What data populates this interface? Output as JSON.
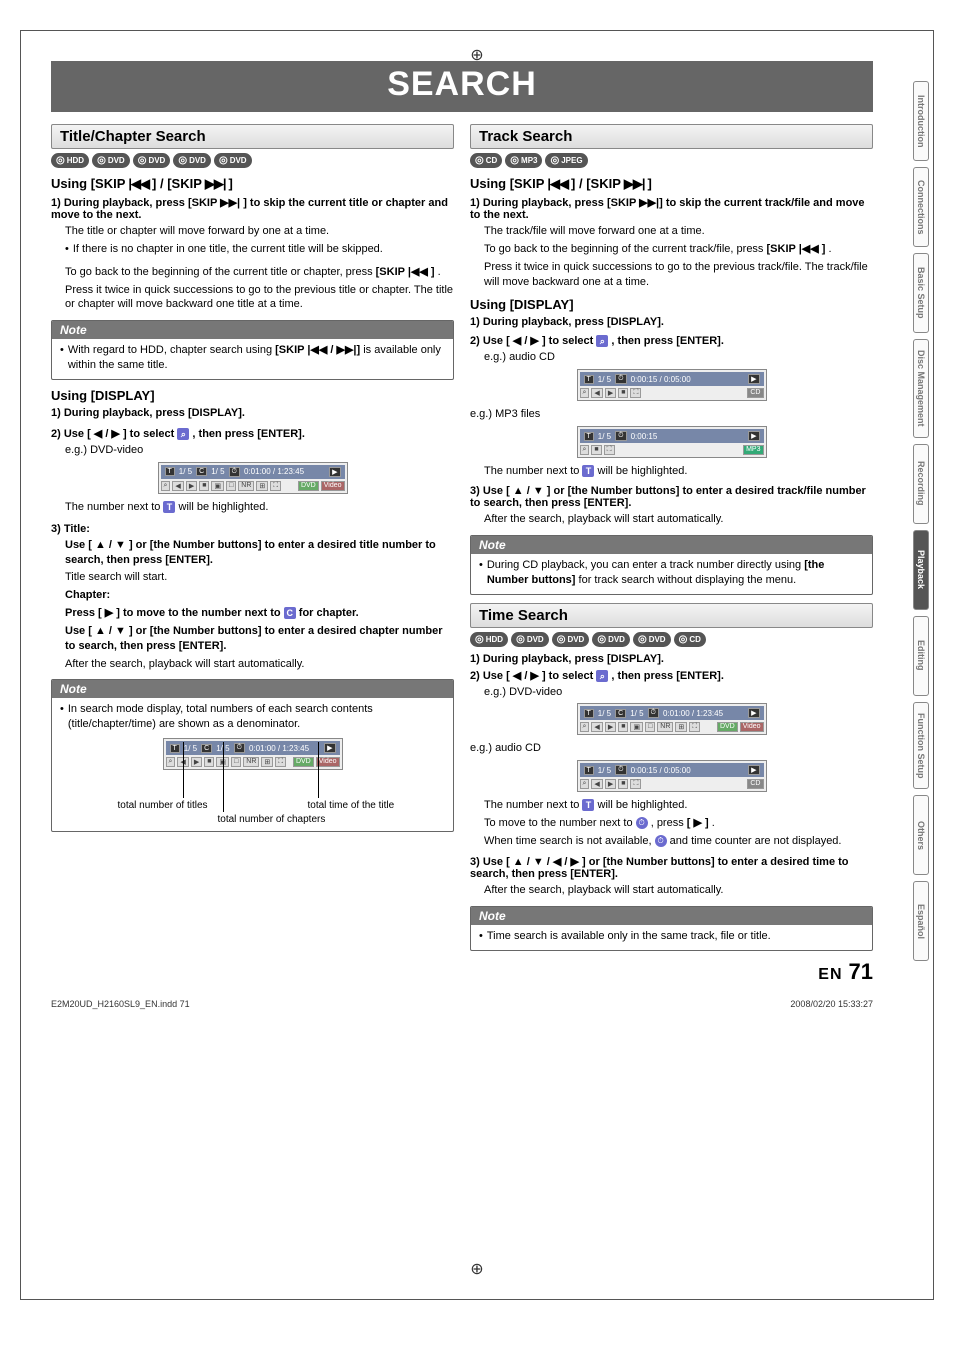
{
  "page_title": "SEARCH",
  "left": {
    "section1": {
      "heading": "Title/Chapter Search",
      "discs": [
        "HDD",
        "DVD",
        "DVD",
        "DVD",
        "DVD"
      ],
      "sub_heading_prefix": "Using [SKIP ",
      "sub_heading_mid": " ] / [SKIP ",
      "sub_heading_suffix": " ]",
      "step1_label": "1)",
      "step1_bold": "During playback, press [SKIP ▶▶| ] to skip the current title or chapter and move to the next.",
      "step1_line1": "The title or chapter will move forward by one at a time.",
      "step1_bullet": "If there is no chapter in one title, the current title will be skipped.",
      "step1_line2a": "To go back to the beginning of the current title or chapter, press ",
      "step1_line2b": "[SKIP |◀◀ ]",
      "step1_line2c": ".",
      "step1_line3": "Press it twice in quick successions to go to the previous title or chapter. The title or chapter will move backward one title at a time.",
      "note_title": "Note",
      "note_body_a": "With regard to HDD, chapter search using ",
      "note_body_b": "[SKIP |◀◀ / ▶▶|]",
      "note_body_c": " is available only within the same title."
    },
    "section2": {
      "heading": "Using [DISPLAY]",
      "step1_label": "1)",
      "step1": "During playback, press [DISPLAY].",
      "step2_label": "2)",
      "step2_a": "Use [ ◀ / ▶ ] to select ",
      "step2_b": " , then press [ENTER].",
      "eg_label": "e.g.) DVD-video",
      "eg_time": "0:01:00 / 1:23:45",
      "eg_tc": "1/  5",
      "eg_cc": "1/  5",
      "eg_badges": [
        "DVD",
        "Video"
      ],
      "after_eg_a": "The number next to ",
      "after_eg_b": " will be highlighted.",
      "step3_label": "3)",
      "step3_heading": "Title:",
      "step3_title_line1": "Use [ ▲ / ▼ ] or [the Number buttons] to enter a desired title number to search, then press [ENTER].",
      "step3_title_line2": "Title search will start.",
      "step3_chapter_heading": "Chapter:",
      "step3_chapter_line1a": "Press [ ▶ ] to move to the number next to ",
      "step3_chapter_line1b": " for chapter.",
      "step3_chapter_line2": "Use [ ▲ / ▼ ] or [the Number buttons] to enter a desired chapter number to search, then press [ENTER].",
      "step3_after": "After the search, playback will start automatically.",
      "note_title": "Note",
      "note_body": "In search mode display, total numbers of each search contents (title/chapter/time) are shown as a denominator.",
      "diagram_eg_tc": "1/  5",
      "diagram_eg_cc": "1/  5",
      "diagram_eg_time": "0:01:00 / 1:23:45",
      "diagram_label1": "total number of titles",
      "diagram_label2": "total number of chapters",
      "diagram_label3": "total time of the title"
    }
  },
  "right": {
    "section1": {
      "heading": "Track Search",
      "discs": [
        "CD",
        "MP3",
        "JPEG"
      ],
      "sub_heading_prefix": "Using [SKIP ",
      "sub_heading_mid": " ] / [SKIP ",
      "sub_heading_suffix": " ]",
      "step1_label": "1)",
      "step1_bold": "During playback, press [SKIP ▶▶|] to skip the current track/file and move to the next.",
      "step1_line1": "The track/file will move forward one at a time.",
      "step1_line2a": "To go back to the beginning of the current track/file, press ",
      "step1_line2b": "[SKIP |◀◀ ]",
      "step1_line2c": ".",
      "step1_line3": "Press it twice in quick successions to go to the previous track/file. The track/file will move backward one at a time."
    },
    "section2": {
      "heading": "Using [DISPLAY]",
      "step1_label": "1)",
      "step1": "During playback, press [DISPLAY].",
      "step2_label": "2)",
      "step2_a": "Use [ ◀ / ▶ ] to select ",
      "step2_b": " , then press [ENTER].",
      "eg1_label": "e.g.) audio CD",
      "eg1_time": "0:00:15 / 0:05:00",
      "eg1_tc": "1/  5",
      "eg1_badge": "CD",
      "eg2_label": "e.g.) MP3 files",
      "eg2_time": "0:00:15",
      "eg2_tc": "1/  5",
      "eg2_badge": "MP3",
      "after_eg_a": "The number next to ",
      "after_eg_b": " will be highlighted.",
      "step3_label": "3)",
      "step3_bold": "Use [ ▲ / ▼ ] or [the Number buttons] to enter a desired track/file number to search, then press [ENTER].",
      "step3_after": "After the search, playback will start automatically.",
      "note_title": "Note",
      "note_body_a": "During CD playback, you can enter a track number directly using ",
      "note_body_b": "[the Number buttons]",
      "note_body_c": " for track search without displaying the menu."
    },
    "section3": {
      "heading": "Time Search",
      "discs": [
        "HDD",
        "DVD",
        "DVD",
        "DVD",
        "DVD",
        "CD"
      ],
      "step1_label": "1)",
      "step1": "During playback, press [DISPLAY].",
      "step2_label": "2)",
      "step2_a": "Use [ ◀ / ▶ ] to select ",
      "step2_b": " , then press [ENTER].",
      "eg1_label": "e.g.) DVD-video",
      "eg1_time": "0:01:00 / 1:23:45",
      "eg1_tc": "1/  5",
      "eg1_cc": "1/  5",
      "eg1_badges": [
        "DVD",
        "Video"
      ],
      "eg2_label": "e.g.) audio CD",
      "eg2_time": "0:00:15 / 0:05:00",
      "eg2_tc": "1/  5",
      "eg2_badge": "CD",
      "after1_a": "The number next to ",
      "after1_b": " will be highlighted.",
      "after2_a": "To move to the number next to ",
      "after2_b": " , press ",
      "after2_c": "[ ▶ ]",
      "after2_d": ".",
      "after3_a": "When time search is not available, ",
      "after3_b": " and time counter are not displayed.",
      "step3_label": "3)",
      "step3_bold": "Use [ ▲ / ▼ / ◀ / ▶ ] or [the Number buttons] to enter a desired time to search, then press [ENTER].",
      "step3_after": "After the search, playback will start automatically.",
      "note_title": "Note",
      "note_body": "Time search is available only in the same track, file or title."
    }
  },
  "side_tabs": [
    "Introduction",
    "Connections",
    "Basic Setup",
    "Disc Management",
    "Recording",
    "Playback",
    "Editing",
    "Function Setup",
    "Others",
    "Español"
  ],
  "side_active_index": 5,
  "footer_left": "E2M20UD_H2160SL9_EN.indd   71",
  "footer_right": "2008/02/20   15:33:27",
  "page_en": "EN",
  "page_num": "71"
}
